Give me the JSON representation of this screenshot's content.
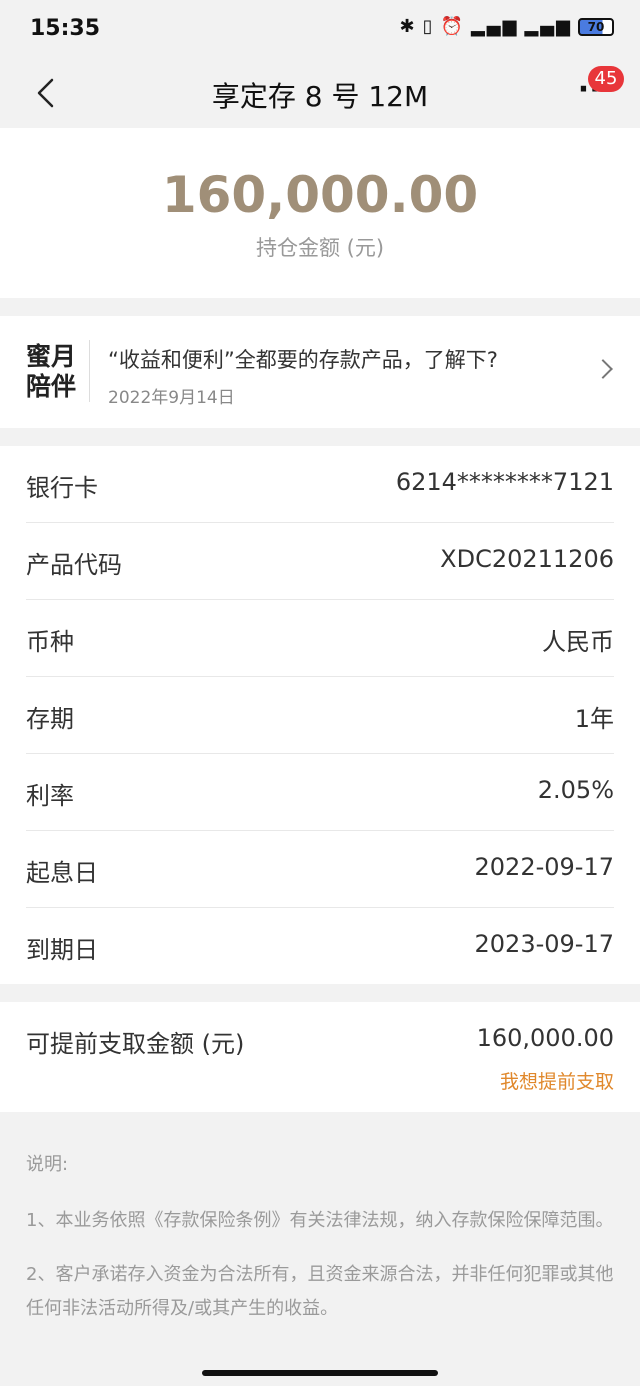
{
  "status_bar": {
    "time": "15:35",
    "battery": "70"
  },
  "nav": {
    "title": "享定存 8 号 12M",
    "badge_count": "45"
  },
  "holding": {
    "amount": "160,000.00",
    "label": "持仓金额 (元)"
  },
  "promo": {
    "logo_line1": "蜜月",
    "logo_line2": "陪伴",
    "text": "“收益和便利”全都要的存款产品，了解下?",
    "date": "2022年9月14日"
  },
  "details": [
    {
      "label": "银行卡",
      "value": "6214********7121"
    },
    {
      "label": "产品代码",
      "value": "XDC20211206"
    },
    {
      "label": "币种",
      "value": "人民币"
    },
    {
      "label": "存期",
      "value": "1年"
    },
    {
      "label": "利率",
      "value": "2.05%"
    },
    {
      "label": "起息日",
      "value": "2022-09-17"
    },
    {
      "label": "到期日",
      "value": "2023-09-17"
    }
  ],
  "withdraw": {
    "label": "可提前支取金额 (元)",
    "amount": "160,000.00",
    "link": "我想提前支取"
  },
  "notes": {
    "title": "说明:",
    "items": [
      "1、本业务依照《存款保险条例》有关法律法规，纳入存款保险保障范围。",
      "2、客户承诺存入资金为合法所有，且资金来源合法，并非任何犯罪或其他任何非法活动所得及/或其产生的收益。"
    ]
  },
  "colors": {
    "amount": "#a08f78",
    "badge": "#e8363a",
    "link": "#e0882c"
  }
}
